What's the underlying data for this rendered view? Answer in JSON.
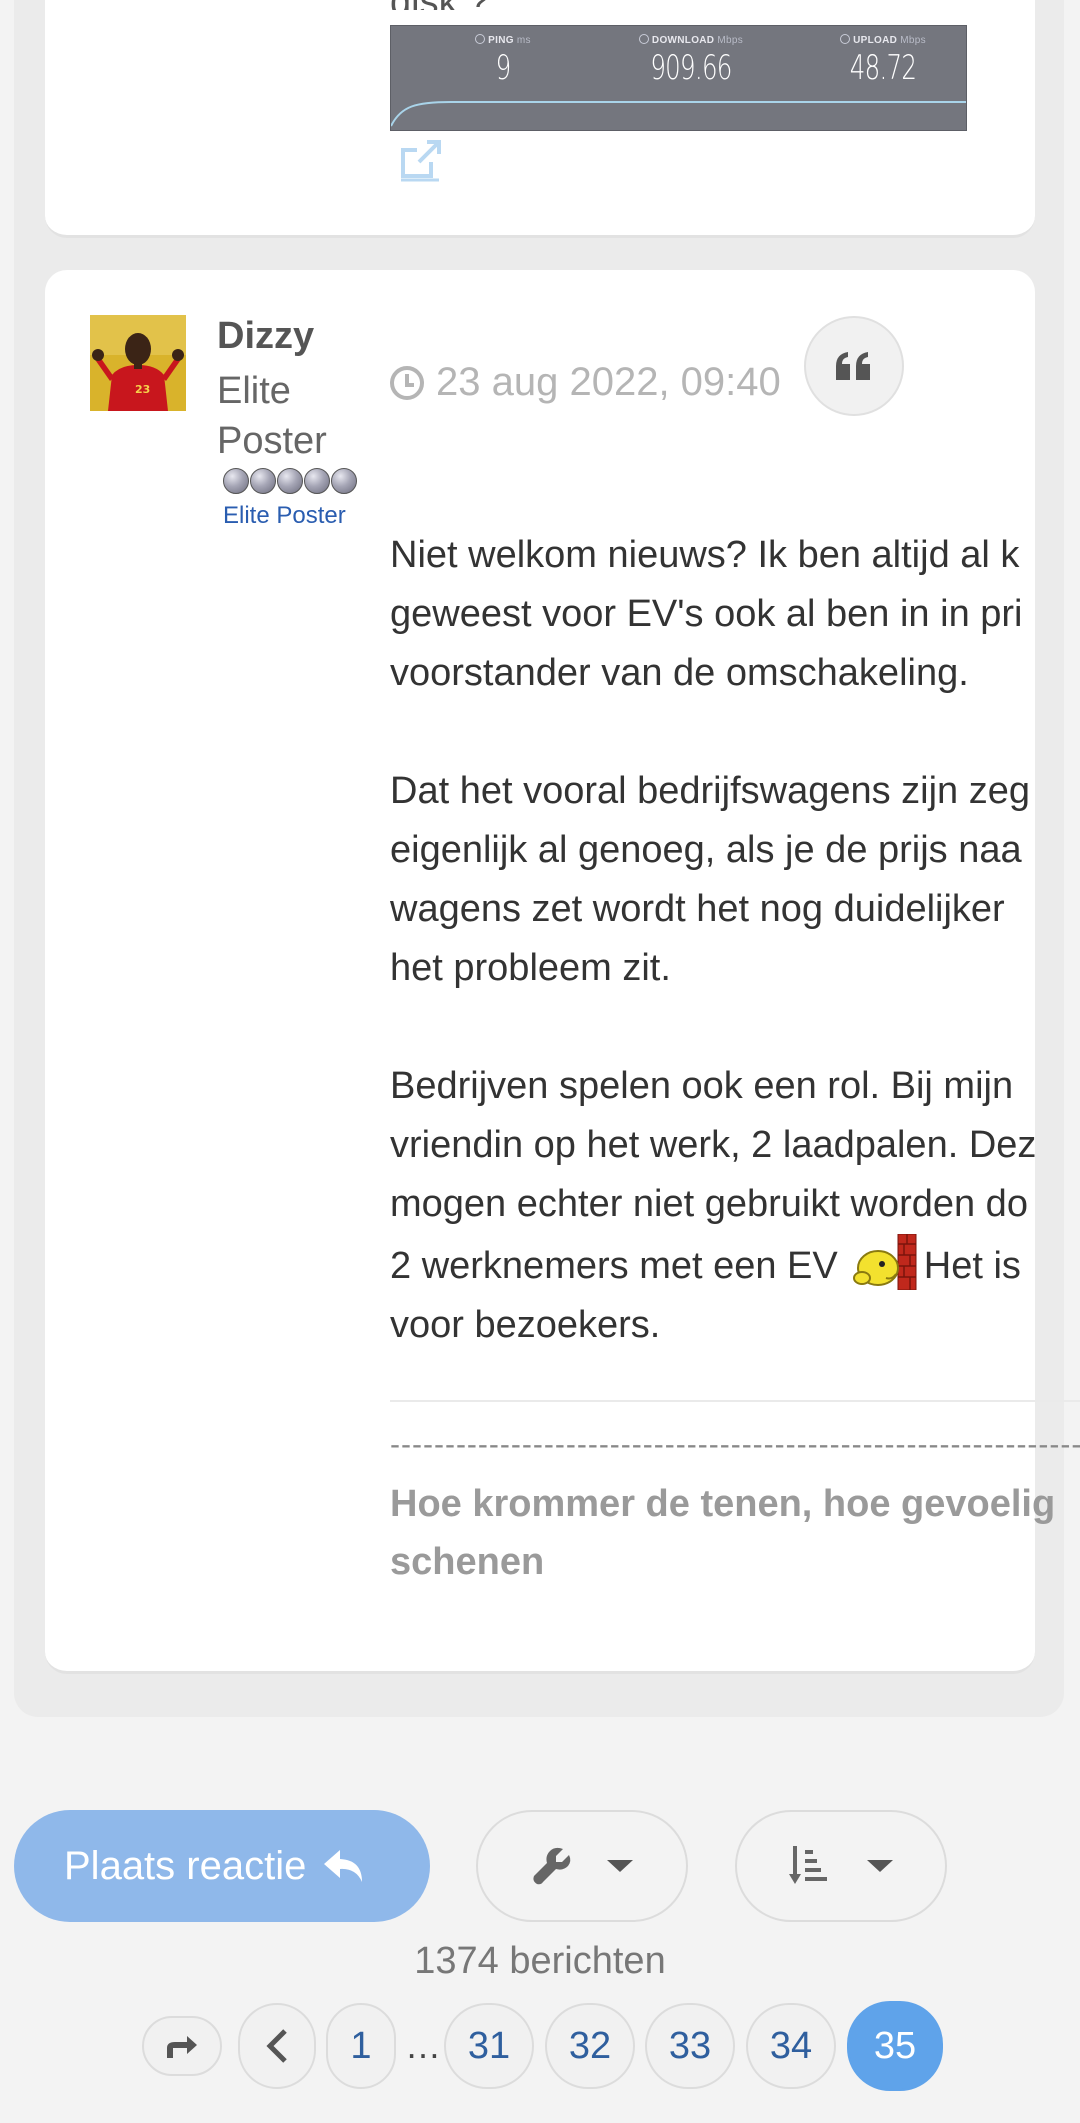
{
  "previous_post": {
    "trailing_text": "disk ?",
    "speedtest": {
      "ping": {
        "label": "PING",
        "unit": "ms",
        "value": "9"
      },
      "download": {
        "label": "DOWNLOAD",
        "unit": "Mbps",
        "value": "909.66"
      },
      "upload": {
        "label": "UPLOAD",
        "unit": "Mbps",
        "value": "48.72"
      }
    }
  },
  "post": {
    "username": "Dizzy",
    "rank": "Elite Poster",
    "rank_label": "Elite Poster",
    "rank_pips": 5,
    "date": "23 aug 2022, 09:40",
    "paragraphs": [
      {
        "lines": [
          "Niet welkom nieuws? Ik ben altijd al k",
          "geweest voor EV's ook al ben in in pri",
          "voorstander van de omschakeling."
        ]
      },
      {
        "lines": [
          "Dat het vooral bedrijfswagens zijn zeg",
          "eigenlijk al genoeg, als je de prijs naa",
          "wagens zet wordt het nog duidelijker",
          "het probleem zit."
        ]
      },
      {
        "lines": [
          "Bedrijven spelen ook een rol. Bij mijn",
          "vriendin op het werk, 2 laadpalen. Dez",
          "mogen echter niet gebruikt worden do"
        ]
      }
    ],
    "smiley_line_before": "2 werknemers met een EV",
    "smiley_line_after": "Het is",
    "last_line": "voor bezoekers.",
    "signature_dashes": "------------------------------------------------------------------------",
    "signature": [
      "Hoe krommer de tenen, hoe gevoelig",
      "schenen"
    ]
  },
  "actions": {
    "reply_label": "Plaats reactie",
    "post_count": "1374 berichten"
  },
  "pagination": {
    "pages": [
      "1",
      "31",
      "32",
      "33",
      "34",
      "35"
    ],
    "ellipsis": "…",
    "current": "35"
  },
  "colors": {
    "accent": "#5fa3ea",
    "reply_button": "#8fb8ea",
    "rank_text": "#2a5db0"
  }
}
